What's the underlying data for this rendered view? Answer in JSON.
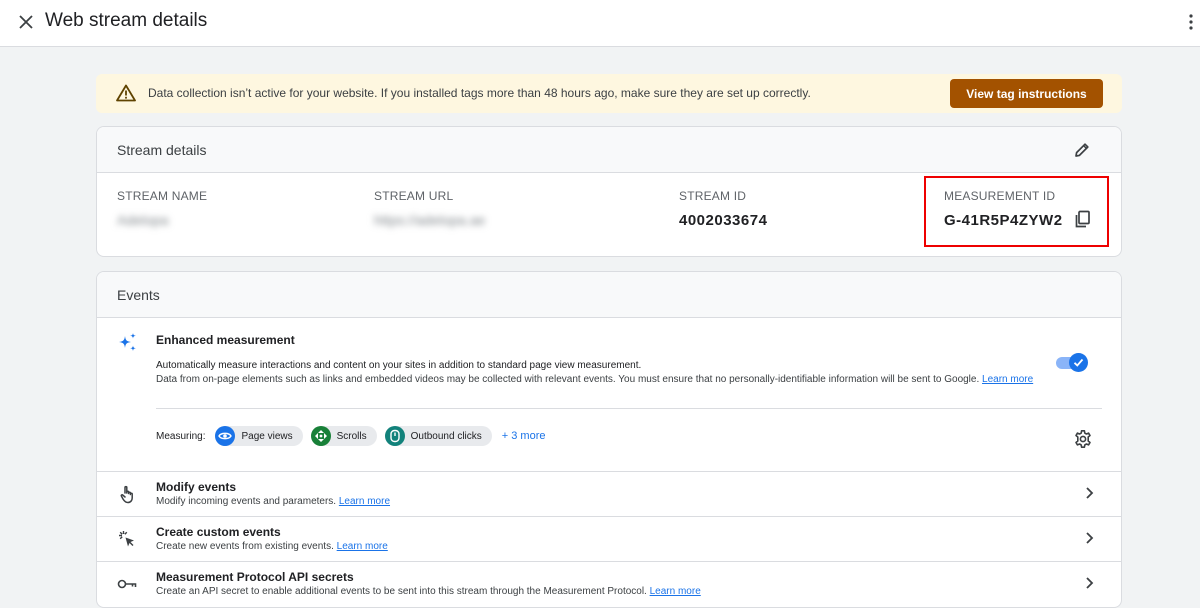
{
  "header": {
    "title": "Web stream details"
  },
  "banner": {
    "text": "Data collection isn’t active for your website. If you installed tags more than 48 hours ago, make sure they are set up correctly.",
    "button_label": "View tag instructions"
  },
  "stream_details": {
    "title": "Stream details",
    "stream_name": {
      "label": "STREAM NAME",
      "value": "Adelopa"
    },
    "stream_url": {
      "label": "STREAM URL",
      "value": "https://adelopa.ae"
    },
    "stream_id": {
      "label": "STREAM ID",
      "value": "4002033674"
    },
    "measurement_id": {
      "label": "MEASUREMENT ID",
      "value": "G-41R5P4ZYW2"
    }
  },
  "events": {
    "title": "Events",
    "enhanced": {
      "title": "Enhanced measurement",
      "desc1": "Automatically measure interactions and content on your sites in addition to standard page view measurement.",
      "desc2": "Data from on-page elements such as links and embedded videos may be collected with relevant events. You must ensure that no personally-identifiable information will be sent to Google.",
      "learn_more": "Learn more",
      "enabled": true,
      "measuring_label": "Measuring:",
      "chips": [
        {
          "label": "Page views",
          "icon": "eye-icon",
          "color": "#1a73e8"
        },
        {
          "label": "Scrolls",
          "icon": "scroll-icon",
          "color": "#188038"
        },
        {
          "label": "Outbound clicks",
          "icon": "outbound-icon",
          "color": "#12827b"
        }
      ],
      "more_label": "+ 3 more"
    },
    "rows": [
      {
        "title": "Modify events",
        "desc": "Modify incoming events and parameters.",
        "link": "Learn more",
        "icon": "touch-icon"
      },
      {
        "title": "Create custom events",
        "desc": "Create new events from existing events.",
        "link": "Learn more",
        "icon": "click-icon"
      },
      {
        "title": "Measurement Protocol API secrets",
        "desc": "Create an API secret to enable additional events to be sent into this stream through the Measurement Protocol.",
        "link": "Learn more",
        "icon": "key-icon"
      }
    ]
  },
  "colors": {
    "accent": "#1a73e8",
    "banner_bg": "#fef7e0",
    "banner_button": "#a35200",
    "highlight": "#ee0000"
  }
}
